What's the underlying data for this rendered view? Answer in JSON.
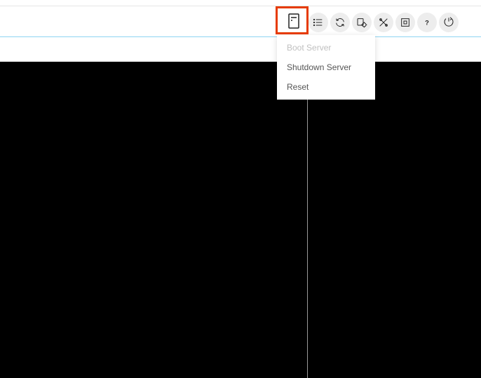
{
  "toolbar": {
    "server_icon": "server-icon",
    "list_icon": "list-icon",
    "refresh_icon": "refresh-icon",
    "settings_icon": "settings-gear-icon",
    "tools_icon": "tools-icon",
    "fullscreen_icon": "fullscreen-icon",
    "help_icon": "help-icon",
    "logout_icon": "logout-icon"
  },
  "dropdown": {
    "items": [
      {
        "label": "Boot Server",
        "disabled": true
      },
      {
        "label": "Shutdown Server",
        "disabled": false
      },
      {
        "label": "Reset",
        "disabled": false
      }
    ]
  }
}
